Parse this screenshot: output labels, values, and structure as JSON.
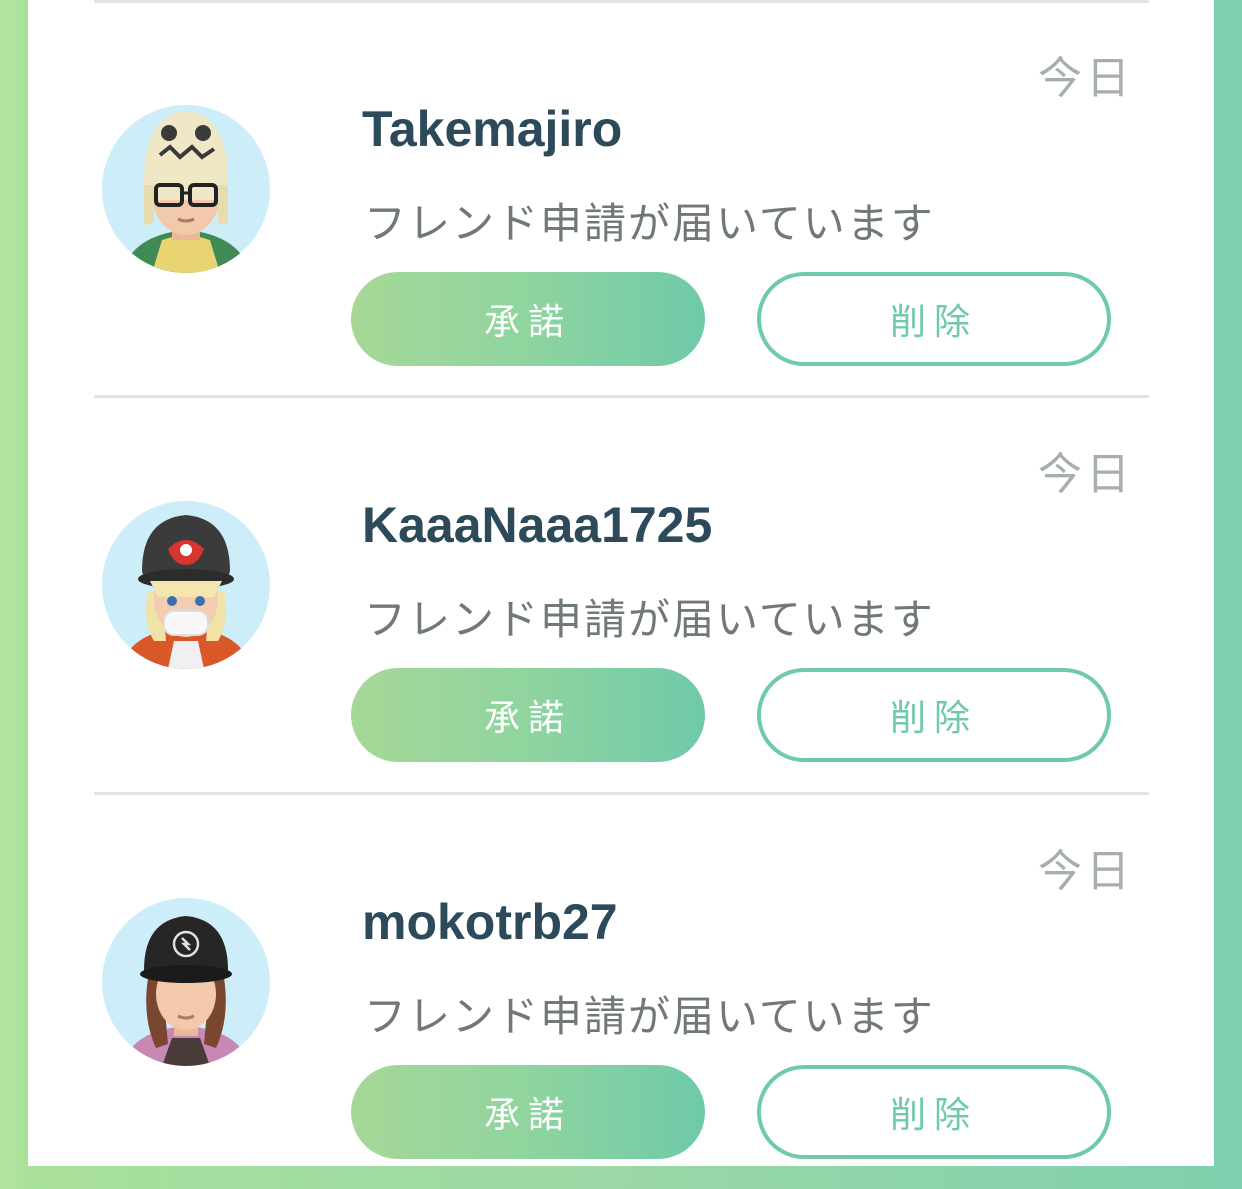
{
  "requests": [
    {
      "name": "Takemajiro",
      "message": "フレンド申請が届いています",
      "time": "今日",
      "accept_label": "承諾",
      "delete_label": "削除",
      "avatar": "trainer-avatar-mimikyu-hat"
    },
    {
      "name": "KaaaNaaa1725",
      "message": "フレンド申請が届いています",
      "time": "今日",
      "accept_label": "承諾",
      "delete_label": "削除",
      "avatar": "trainer-avatar-red-cap"
    },
    {
      "name": "mokotrb27",
      "message": "フレンド申請が届いています",
      "time": "今日",
      "accept_label": "承諾",
      "delete_label": "削除",
      "avatar": "trainer-avatar-black-cap"
    }
  ],
  "colors": {
    "accent": "#6fcaa9",
    "accent_light": "#a6d897",
    "name_text": "#2c4a5a",
    "message_text": "#707878",
    "time_text": "#a7aeae"
  }
}
